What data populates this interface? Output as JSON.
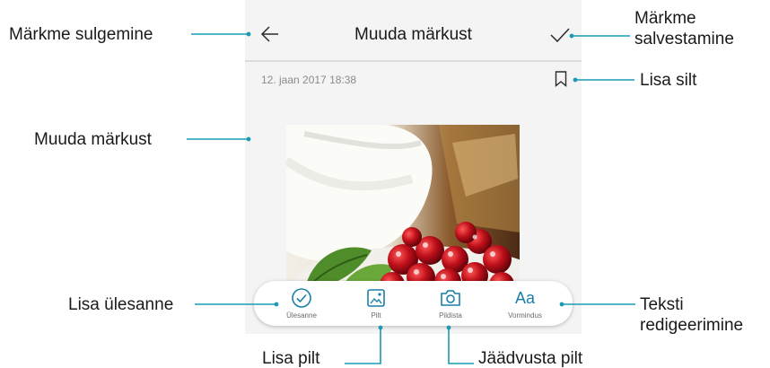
{
  "screen": {
    "title": "Muuda märkust",
    "timestamp": "12. jaan 2017 18:38",
    "toolbar": [
      {
        "label": "Ülesanne",
        "icon": "check-circle-icon"
      },
      {
        "label": "Pilt",
        "icon": "image-icon"
      },
      {
        "label": "Pildista",
        "icon": "camera-icon"
      },
      {
        "label": "Vormindus",
        "icon": "text-format-icon",
        "glyph": "Aa"
      }
    ],
    "icons": {
      "back": "back-arrow-icon",
      "save": "checkmark-icon",
      "tag": "bookmark-icon"
    }
  },
  "annotations": {
    "close_note": "Märkme sulgemine",
    "save_note": [
      "Märkme",
      "salvestamine"
    ],
    "add_tag": "Lisa silt",
    "edit_note": "Muuda märkust",
    "add_task": "Lisa ülesanne",
    "edit_text": [
      "Teksti",
      "redigeerimine"
    ],
    "add_image": "Lisa pilt",
    "capture_image": "Jäädvusta pilt"
  },
  "colors": {
    "accent": "#1a9bb3",
    "toolbar_icon": "#1a7fa8"
  }
}
